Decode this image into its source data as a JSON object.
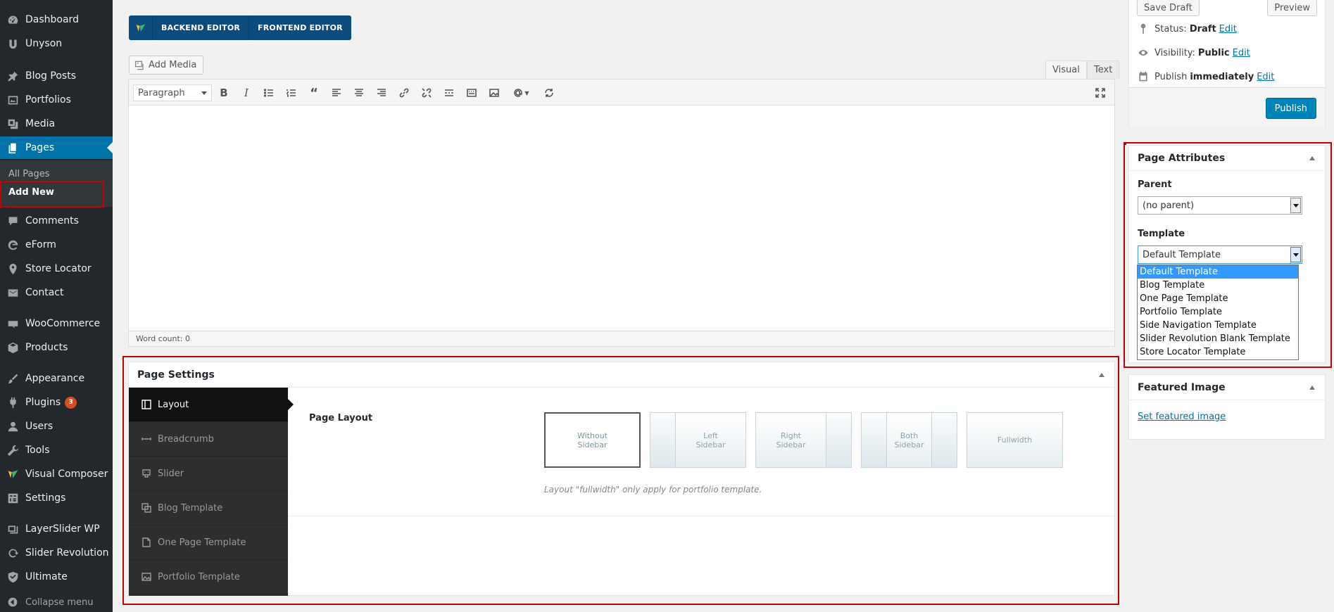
{
  "sidebar": {
    "items": [
      {
        "label": "Dashboard",
        "icon": "dashboard-icon"
      },
      {
        "label": "Unyson",
        "icon": "unyson-icon"
      },
      {
        "label": "Blog Posts",
        "icon": "pin-icon"
      },
      {
        "label": "Portfolios",
        "icon": "portfolio-icon"
      },
      {
        "label": "Media",
        "icon": "media-icon"
      },
      {
        "label": "Pages",
        "icon": "pages-icon"
      },
      {
        "label": "Comments",
        "icon": "comment-icon"
      },
      {
        "label": "eForm",
        "icon": "eform-icon"
      },
      {
        "label": "Store Locator",
        "icon": "location-pin-icon"
      },
      {
        "label": "Contact",
        "icon": "mail-icon"
      },
      {
        "label": "WooCommerce",
        "icon": "woocommerce-icon"
      },
      {
        "label": "Products",
        "icon": "products-icon"
      },
      {
        "label": "Appearance",
        "icon": "brush-icon"
      },
      {
        "label": "Plugins",
        "icon": "plugin-icon",
        "badge": "3"
      },
      {
        "label": "Users",
        "icon": "users-icon"
      },
      {
        "label": "Tools",
        "icon": "wrench-icon"
      },
      {
        "label": "Visual Composer",
        "icon": "visual-composer-icon"
      },
      {
        "label": "Settings",
        "icon": "settings-icon"
      },
      {
        "label": "LayerSlider WP",
        "icon": "layers-icon"
      },
      {
        "label": "Slider Revolution",
        "icon": "refresh-icon"
      },
      {
        "label": "Ultimate",
        "icon": "shield-icon"
      }
    ],
    "submenu": {
      "all_pages": "All Pages",
      "add_new": "Add New"
    },
    "collapse": "Collapse menu",
    "active_color": "#0073aa"
  },
  "editor": {
    "backend": "BACKEND EDITOR",
    "frontend": "FRONTEND EDITOR",
    "add_media": "Add Media",
    "tab_visual": "Visual",
    "tab_text": "Text",
    "format": "Paragraph",
    "word_count": "Word count: 0"
  },
  "page_settings": {
    "title": "Page Settings",
    "tabs": [
      "Layout",
      "Breadcrumb",
      "Slider",
      "Blog Template",
      "One Page Template",
      "Portfolio Template"
    ],
    "layout_label": "Page Layout",
    "options": [
      "Without Sidebar",
      "Left Sidebar",
      "Right Sidebar",
      "Both Sidebar",
      "Fullwidth"
    ],
    "note": "Layout \"fullwidth\" only apply for portfolio template."
  },
  "publish": {
    "save_draft": "Save Draft",
    "preview": "Preview",
    "status_label": "Status:",
    "status_value": "Draft",
    "visibility_label": "Visibility:",
    "visibility_value": "Public",
    "publish_label": "Publish",
    "publish_value": "immediately",
    "edit": "Edit",
    "publish_button": "Publish",
    "button_color": "#0085ba"
  },
  "attributes": {
    "title": "Page Attributes",
    "parent_label": "Parent",
    "parent_value": "(no parent)",
    "template_label": "Template",
    "template_value": "Default Template",
    "template_options": [
      "Default Template",
      "Blog Template",
      "One Page Template",
      "Portfolio Template",
      "Side Navigation Template",
      "Slider Revolution Blank Template",
      "Store Locator Template"
    ]
  },
  "featured": {
    "title": "Featured Image",
    "link": "Set featured image"
  },
  "highlight_color": "#c40000"
}
